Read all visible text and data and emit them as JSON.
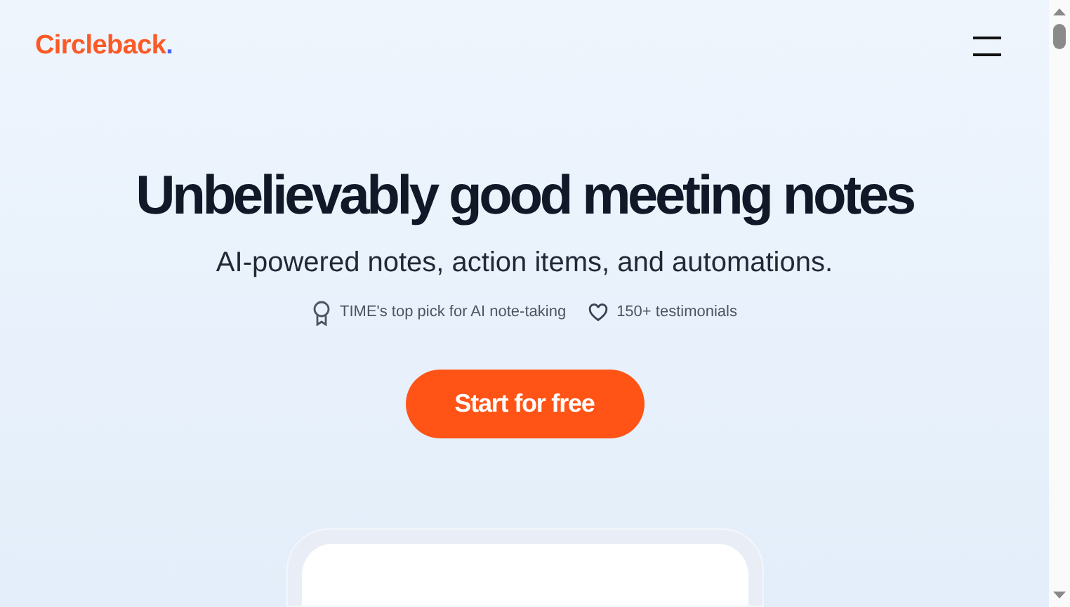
{
  "header": {
    "logo": "Circleback",
    "logo_dot": "."
  },
  "hero": {
    "title": "Unbelievably good meeting notes",
    "subtitle": "AI-powered notes, action items, and automations.",
    "badges": [
      {
        "kind": "award",
        "text": "TIME's top pick for AI note-taking"
      },
      {
        "kind": "heart",
        "text": "150+ testimonials"
      }
    ],
    "cta": "Start for free"
  }
}
